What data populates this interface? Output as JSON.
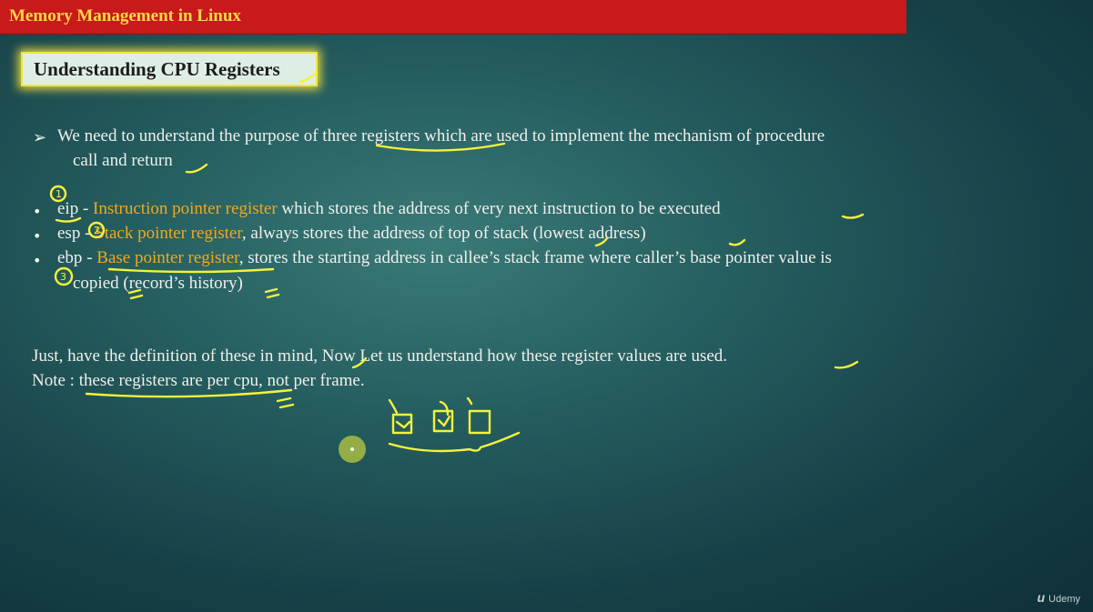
{
  "header": {
    "course_title": "Memory Management in Linux"
  },
  "slide": {
    "title": "Understanding CPU Registers",
    "intro_line1": "We need to understand the purpose of three registers which are used to implement the mechanism of  procedure",
    "intro_line2": "call and return",
    "registers": [
      {
        "name": "eip",
        "separator": "  - ",
        "label": "Instruction pointer register",
        "description": " which stores the address of very next instruction to be executed"
      },
      {
        "name": "esp",
        "separator": " - ",
        "label": "Stack pointer register",
        "description": ", always stores the address of top of stack (lowest address)"
      },
      {
        "name": "ebp",
        "separator": "  - ",
        "label": "Base pointer register",
        "description": ", stores the starting address in callee’s stack frame where caller’s base pointer value is"
      }
    ],
    "ebp_continuation": "copied (record’s history)",
    "closing_line": "Just, have the definition of these in mind, Now Let us understand how these register values are used.",
    "note_line": "Note : these registers are per cpu, not per frame."
  },
  "annotations": {
    "numbers": [
      "1",
      "2",
      "3"
    ],
    "ink_color": "#f4f23a"
  },
  "branding": {
    "mark": "u",
    "name": "Udemy"
  }
}
